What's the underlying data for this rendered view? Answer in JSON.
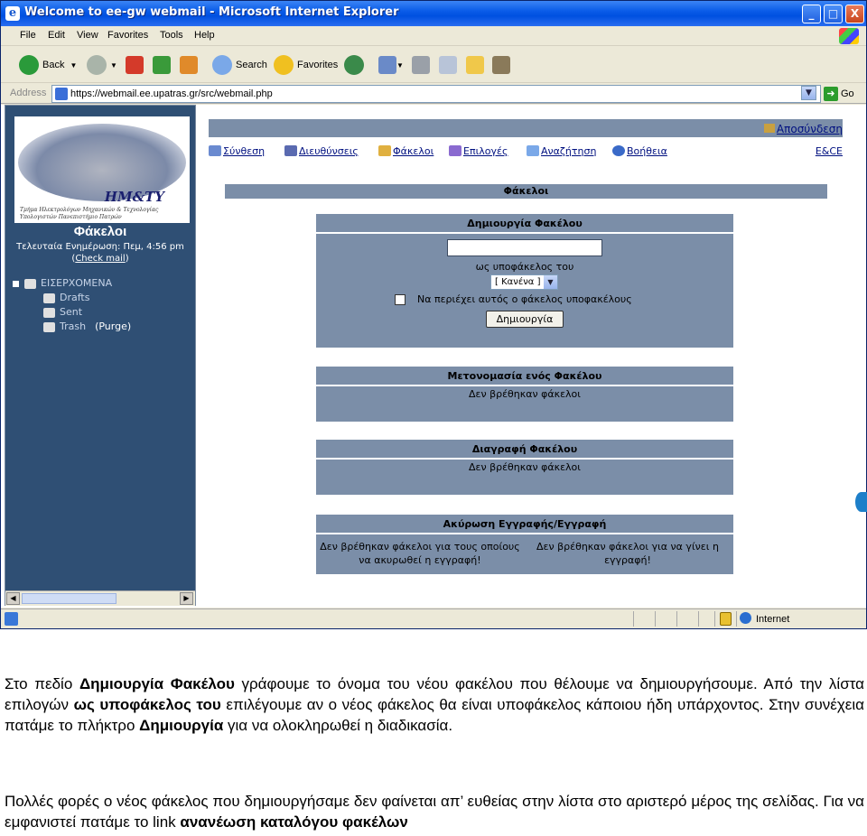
{
  "window": {
    "title": "Welcome to ee-gw webmail - Microsoft Internet Explorer",
    "controls": [
      "_",
      "□",
      "X"
    ]
  },
  "menu": [
    "File",
    "Edit",
    "View",
    "Favorites",
    "Tools",
    "Help"
  ],
  "toolbar": {
    "back": "Back",
    "search": "Search",
    "favorites": "Favorites"
  },
  "address": {
    "label": "Address",
    "url": "https://webmail.ee.upatras.gr/src/webmail.php",
    "go": "Go"
  },
  "left": {
    "logo_text": "HM&TY",
    "logo_sub": "Τμήμα Ηλεκτρολόγων Μηχανικών & Τεχνολογίας Υπολογιστών Πανεπιστήμιο Πατρών",
    "title": "Φάκελοι",
    "updated": "Τελευταία Ενημέρωση: Πεμ, 4:56 pm",
    "check_open": "(",
    "check_mail": "Check mail",
    "check_close": ")",
    "folders": [
      {
        "name": "ΕΙΣΕΡΧΟΜΕΝΑ",
        "icon": "inbox-icon"
      },
      {
        "name": "Drafts",
        "icon": "drafts-icon"
      },
      {
        "name": "Sent",
        "icon": "sent-icon"
      },
      {
        "name": "Trash",
        "icon": "trash-icon"
      }
    ],
    "purge": "(Purge)"
  },
  "top": {
    "logout": "Αποσύνδεση",
    "org": "E&CE",
    "nav": [
      "Σύνθεση",
      "Διευθύνσεις",
      "Φάκελοι",
      "Επιλογές",
      "Αναζήτηση",
      "Βοήθεια"
    ]
  },
  "folders_header": "Φάκελοι",
  "create": {
    "title": "Δημιουργία Φακέλου",
    "input_value": "",
    "as_subfolder": "ως υποφάκελος του",
    "select_value": "[ Κανένα ]",
    "no_subfolders": "Να περιέχει αυτός ο φάκελος υποφακέλους",
    "button": "Δημιουργία"
  },
  "rename": {
    "title": "Μετονομασία ενός Φακέλου",
    "msg": "Δεν βρέθηκαν φάκελοι"
  },
  "delete": {
    "title": "Διαγραφή Φακέλου",
    "msg": "Δεν βρέθηκαν φάκελοι"
  },
  "subscribe": {
    "title": "Ακύρωση Εγγραφής/Εγγραφή",
    "left": "Δεν βρέθηκαν φάκελοι για τους οποίους να ακυρωθεί η εγγραφή!",
    "right": "Δεν βρέθηκαν φάκελοι για να γίνει η εγγραφή!"
  },
  "status": {
    "zone": "Internet"
  },
  "doc": {
    "p1": [
      {
        "t": "Στο πεδίο ",
        "b": false
      },
      {
        "t": "Δημιουργία Φακέλου",
        "b": true
      },
      {
        "t": " γράφουμε το όνομα του νέου φακέλου που θέλουμε να δημιουργήσουμε. Από την λίστα επιλογών ",
        "b": false
      },
      {
        "t": "ως υποφάκελος του",
        "b": true
      },
      {
        "t": " επιλέγουμε αν ο νέος φάκελος θα είναι υποφάκελος κάποιου ήδη υπάρχοντος. Στην συνέχεια πατάμε το πλήκτρο ",
        "b": false
      },
      {
        "t": "Δημιουργία",
        "b": true
      },
      {
        "t": " για να ολοκληρωθεί η διαδικασία.",
        "b": false
      }
    ],
    "p2": [
      {
        "t": "Πολλές φορές ο νέος φάκελος που δημιουργήσαμε δεν φαίνεται απ’ ευθείας στην λίστα στο αριστερό μέρος της σελίδας. Για να εμφανιστεί πατάμε το link ",
        "b": false
      },
      {
        "t": "ανανέωση καταλόγου φακέλων",
        "b": true
      }
    ]
  }
}
